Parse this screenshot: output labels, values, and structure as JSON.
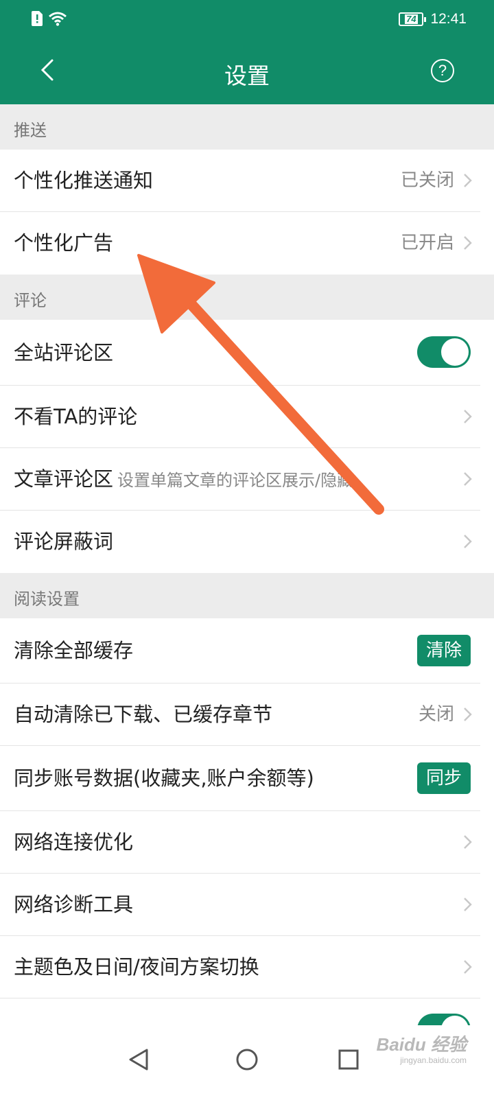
{
  "status_bar": {
    "time": "12:41",
    "battery": "74"
  },
  "app_bar": {
    "title": "设置"
  },
  "sections": {
    "push": {
      "header": "推送",
      "personalized_push": {
        "label": "个性化推送通知",
        "value": "已关闭"
      },
      "personalized_ads": {
        "label": "个性化广告",
        "value": "已开启"
      }
    },
    "comments": {
      "header": "评论",
      "site_comments": {
        "label": "全站评论区",
        "toggle_on": true
      },
      "hide_user_comments": {
        "label": "不看TA的评论"
      },
      "article_comments": {
        "label": "文章评论区",
        "sublabel": "设置单篇文章的评论区展示/隐藏"
      },
      "blocked_words": {
        "label": "评论屏蔽词"
      }
    },
    "reading": {
      "header": "阅读设置",
      "clear_cache": {
        "label": "清除全部缓存",
        "button": "清除"
      },
      "auto_clear": {
        "label": "自动清除已下载、已缓存章节",
        "value": "关闭"
      },
      "sync_account": {
        "label": "同步账号数据(收藏夹,账户余额等)",
        "button": "同步"
      },
      "network_opt": {
        "label": "网络连接优化"
      },
      "network_diag": {
        "label": "网络诊断工具"
      },
      "theme": {
        "label": "主题色及日间/夜间方案切换"
      }
    }
  },
  "watermark": {
    "text": "Baidu 经验",
    "sub": "jingyan.baidu.com"
  },
  "icons": {
    "back": "chevron-left-icon",
    "help": "question-circle-icon",
    "chevron": "chevron-right-icon",
    "nav_back": "triangle-back-icon",
    "nav_home": "circle-home-icon",
    "nav_recent": "square-recent-icon"
  },
  "colors": {
    "primary": "#118c68",
    "annotation_arrow": "#f26b3a"
  }
}
